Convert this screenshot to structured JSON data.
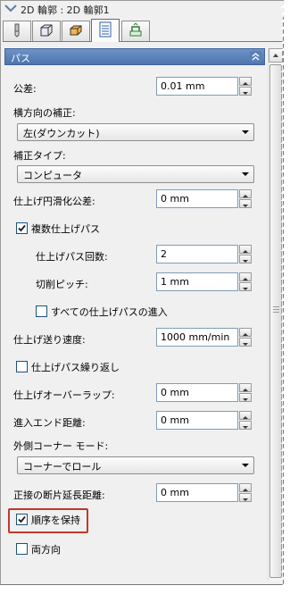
{
  "window": {
    "title": "2D 輪郭 : 2D 輪郭1"
  },
  "tabs": [
    {
      "icon": "tool-icon",
      "active": false
    },
    {
      "icon": "shape-icon",
      "active": false
    },
    {
      "icon": "stock-icon",
      "active": false
    },
    {
      "icon": "list-params-icon",
      "active": true
    },
    {
      "icon": "linking-icon",
      "active": false
    }
  ],
  "section": {
    "title": "パス",
    "collapse_icon": "double-chevron-up-icon"
  },
  "fields": {
    "tolerance": {
      "label": "公差:",
      "value": "0.01 mm"
    },
    "lateral_comp": {
      "label": "横方向の補正:",
      "value": "左(ダウンカット)"
    },
    "comp_type": {
      "label": "補正タイプ:",
      "value": "コンピュータ"
    },
    "finish_smoothing": {
      "label": "仕上げ円滑化公差:",
      "value": "0 mm"
    },
    "multiple_finish": {
      "label": "複数仕上げパス",
      "checked": true
    },
    "finish_count": {
      "label": "仕上げパス回数:",
      "value": "2"
    },
    "cut_pitch": {
      "label": "切削ピッチ:",
      "value": "1 mm"
    },
    "all_finish_lead": {
      "label": "すべての仕上げパスの進入",
      "checked": false
    },
    "finish_feed": {
      "label": "仕上げ送り速度:",
      "value": "1000 mm/min"
    },
    "repeat_finish": {
      "label": "仕上げパス繰り返し",
      "checked": false
    },
    "finish_overlap": {
      "label": "仕上げオーバーラップ:",
      "value": "0 mm"
    },
    "lead_end_distance": {
      "label": "進入エンド距離:",
      "value": "0 mm"
    },
    "outer_corner": {
      "label": "外側コーナー モード:",
      "value": "コーナーでロール"
    },
    "tangent_extension": {
      "label": "正接の断片延長距離:",
      "value": "0 mm"
    },
    "keep_order": {
      "label": "順序を保持",
      "checked": true
    },
    "both_directions": {
      "label": "両方向",
      "checked": false
    }
  },
  "colors": {
    "section_header": "#5a80b9",
    "highlight_box": "#c0392b",
    "panel_bg": "#f0f0f0"
  }
}
